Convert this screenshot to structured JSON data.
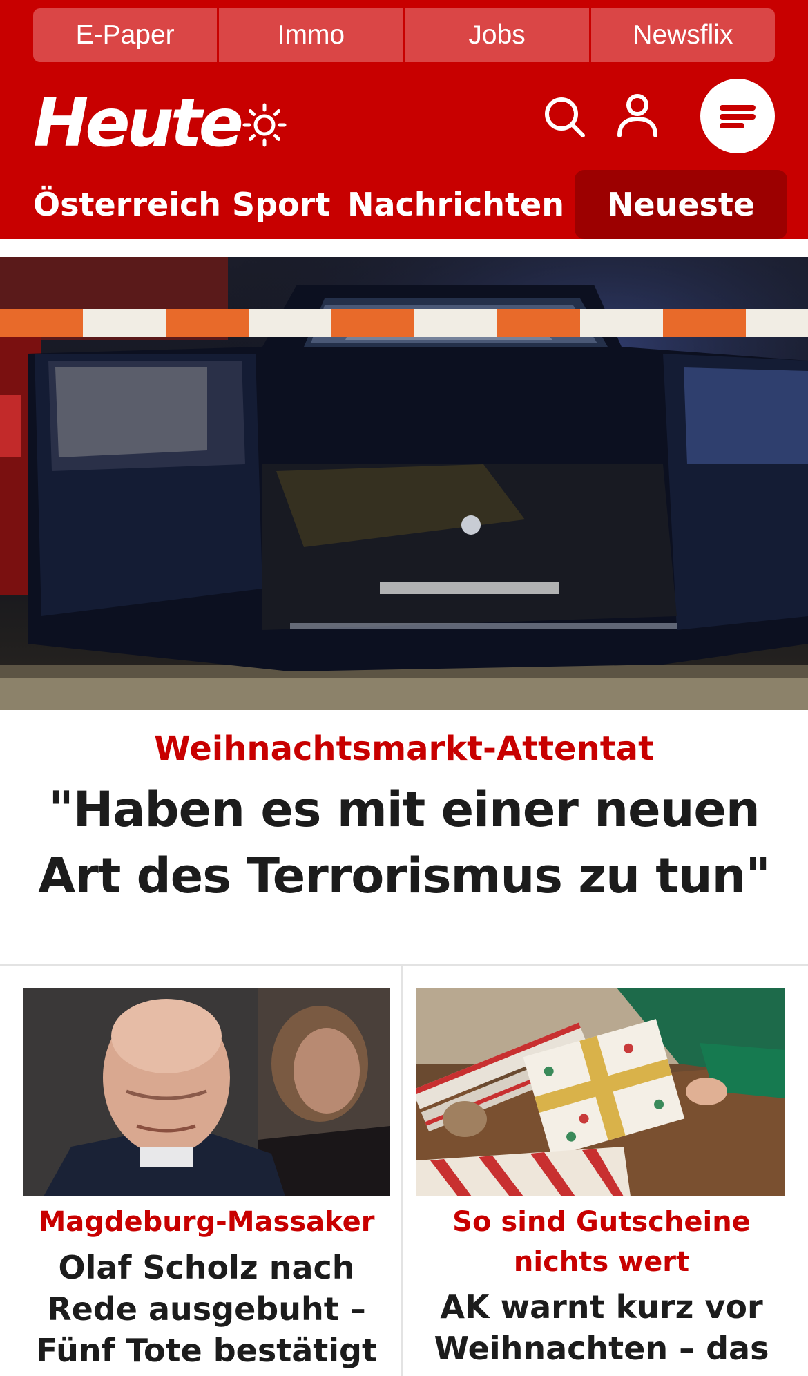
{
  "topbar": {
    "items": [
      {
        "label": "E-Paper"
      },
      {
        "label": "Immo"
      },
      {
        "label": "Jobs"
      },
      {
        "label": "Newsflix"
      }
    ]
  },
  "header": {
    "logo_text": "Heute",
    "icons": [
      "sun-icon",
      "search-icon",
      "user-icon",
      "menu-icon"
    ],
    "brand_color": "#c80000"
  },
  "nav": {
    "items": [
      {
        "label": "Österreich"
      },
      {
        "label": "Sport"
      },
      {
        "label": "Nachrichten"
      }
    ],
    "active_label": "Neueste"
  },
  "hero": {
    "kicker": "Weihnachtsmarkt-Attentat",
    "title": "\"Haben es mit einer neuen Art des Terrorismus zu tun\""
  },
  "cards": [
    {
      "kicker": "Magdeburg-Massaker",
      "title": "Olaf Scholz nach Rede ausgebuht – Fünf Tote bestätigt"
    },
    {
      "kicker": "So sind Gutscheine nichts wert",
      "title": "AK warnt kurz vor Weihnachten – das"
    }
  ]
}
